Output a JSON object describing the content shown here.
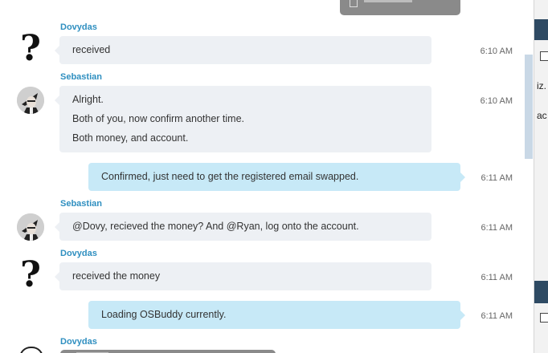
{
  "messages": [
    {
      "sender": "Dovydas",
      "lines": [
        "received"
      ],
      "time": "6:10 AM"
    },
    {
      "sender": "Sebastian",
      "lines": [
        "Alright.",
        "Both of you, now confirm another time.",
        "Both money, and account."
      ],
      "time": "6:10 AM"
    },
    {
      "sender": "",
      "lines": [
        "Confirmed, just need to get the registered email swapped."
      ],
      "time": "6:11 AM"
    },
    {
      "sender": "Sebastian",
      "lines": [
        "@Dovy, recieved the money? And @Ryan, log onto the account."
      ],
      "time": "6:11 AM"
    },
    {
      "sender": "Dovydas",
      "lines": [
        "received the money"
      ],
      "time": "6:11 AM"
    },
    {
      "sender": "",
      "lines": [
        "Loading OSBuddy currently."
      ],
      "time": "6:11 AM"
    },
    {
      "sender": "Dovydas",
      "lines": [],
      "time": ""
    }
  ],
  "right_pane": {
    "snippet1": "iz.",
    "snippet2": "ac"
  },
  "colors": {
    "sender": "#2f8fc0",
    "incoming_bubble": "#edf0f4",
    "outgoing_bubble": "#c7e9f7"
  }
}
